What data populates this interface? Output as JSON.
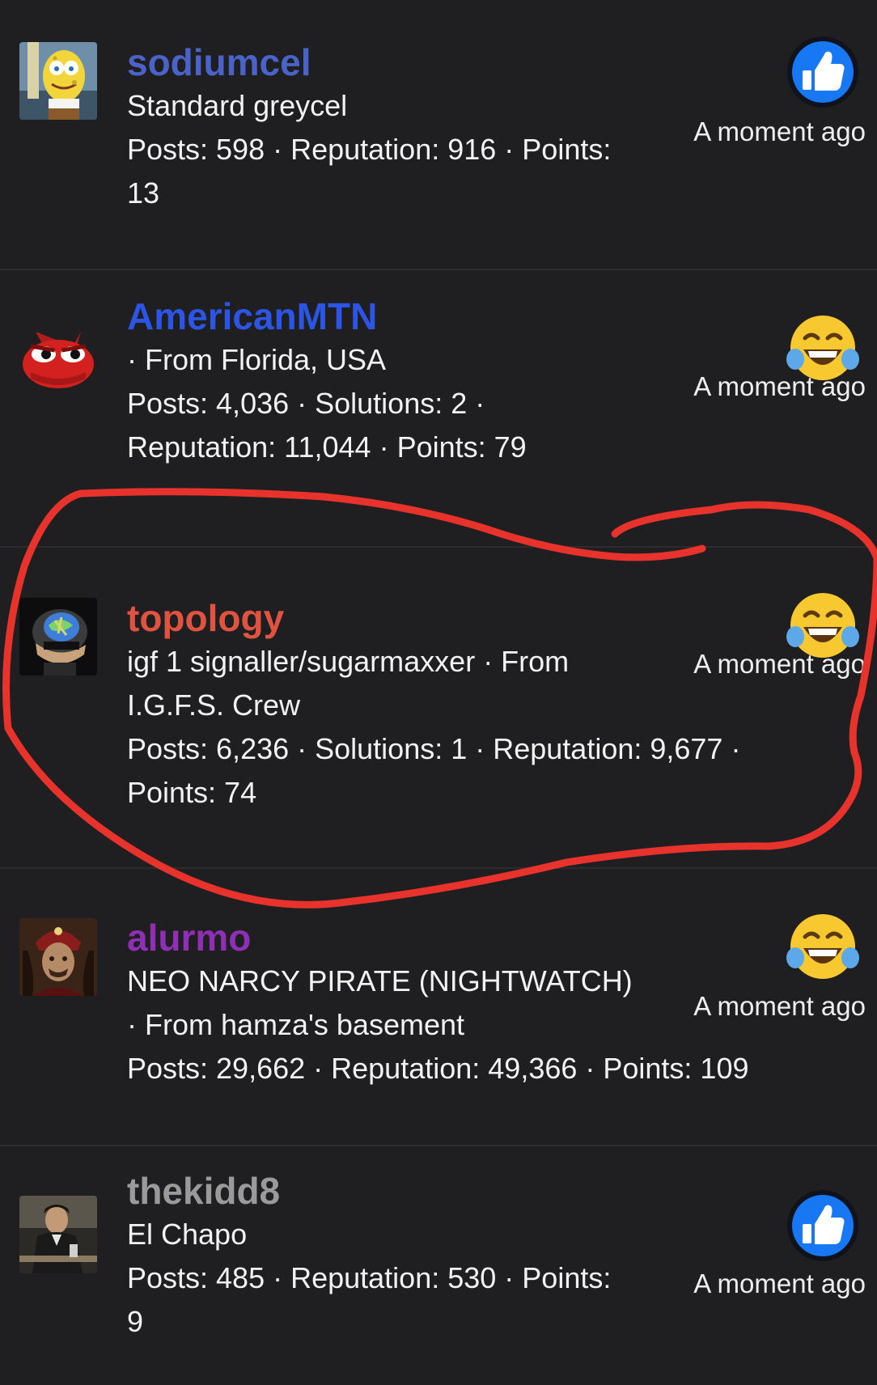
{
  "colors": {
    "background": "#1f1f21",
    "divider": "#2c2c2e",
    "annotation_stroke": "#e8322c"
  },
  "reactions": [
    {
      "user": {
        "name": "sodiumcel",
        "color": "#4a63c9",
        "avatar": "spongebob-avatar"
      },
      "lines": [
        "Standard greycel",
        "Posts: 598 · Reputation: 916 · Points:",
        "13"
      ],
      "reaction_icon": "thumbs-up-icon",
      "time": "A moment ago"
    },
    {
      "user": {
        "name": "AmericanMTN",
        "color": "#2c55e6",
        "avatar": "red-pepe-avatar"
      },
      "lines": [
        "· From Florida, USA",
        "Posts: 4,036 · Solutions: 2 ·",
        "Reputation: 11,044 · Points: 79"
      ],
      "reaction_icon": "laughing-crying-icon",
      "time": "A moment ago"
    },
    {
      "user": {
        "name": "topology",
        "color": "#e05340",
        "avatar": "brain-head-avatar"
      },
      "lines": [
        "igf 1 signaller/sugarmaxxer · From",
        "I.G.F.S. Crew",
        "Posts: 6,236 · Solutions: 1 · Reputation: 9,677 ·",
        "Points: 74"
      ],
      "reaction_icon": "laughing-crying-icon",
      "time": "A moment ago"
    },
    {
      "user": {
        "name": "alurmo",
        "color": "#8e2fb5",
        "avatar": "vlad-portrait-avatar"
      },
      "lines": [
        "NEO NARCY PIRATE (NIGHTWATCH)",
        "· From hamza's basement",
        "Posts: 29,662 · Reputation: 49,366 · Points: 109"
      ],
      "reaction_icon": "laughing-crying-icon",
      "time": "A moment ago"
    },
    {
      "user": {
        "name": "thekidd8",
        "color": "#9a9a9a",
        "avatar": "scarface-avatar"
      },
      "lines": [
        "El Chapo",
        "Posts: 485 · Reputation: 530 · Points:",
        "9"
      ],
      "reaction_icon": "thumbs-up-icon",
      "time": "A moment ago"
    }
  ]
}
